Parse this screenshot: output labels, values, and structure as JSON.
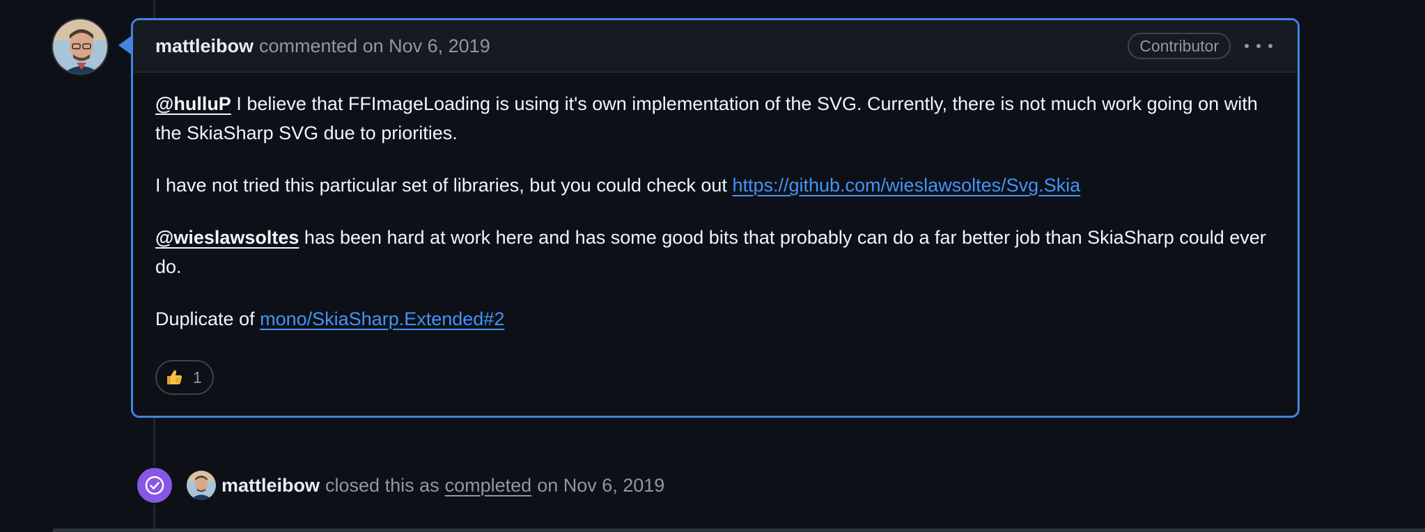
{
  "comment": {
    "author": "mattleibow",
    "meta": "commented on Nov 6, 2019",
    "badge": "Contributor",
    "paragraph1": {
      "mention": "@hulluP",
      "text": " I believe that FFImageLoading is using it's own implementation of the SVG. Currently, there is not much work going on with the SkiaSharp SVG due to priorities."
    },
    "paragraph2": {
      "text": "I have not tried this particular set of libraries, but you could check out ",
      "link": "https://github.com/wieslawsoltes/Svg.Skia"
    },
    "paragraph3": {
      "mention": "@wieslawsoltes",
      "text": " has been hard at work here and has some good bits that probably can do a far better job than SkiaSharp could ever do."
    },
    "paragraph4": {
      "text": "Duplicate of ",
      "link": "mono/SkiaSharp.Extended#2"
    },
    "reaction": {
      "emoji": "thumbs-up",
      "count": "1"
    }
  },
  "event": {
    "author": "mattleibow",
    "text": "closed this as",
    "link": "completed",
    "date": "on Nov 6, 2019"
  },
  "icons": {
    "closed": "check-circle-icon",
    "more": "kebab-horizontal-icon"
  },
  "colors": {
    "accent_border": "#4184e4",
    "link": "#4493f8",
    "closed_badge": "#8957e5",
    "background": "#0d1117"
  }
}
